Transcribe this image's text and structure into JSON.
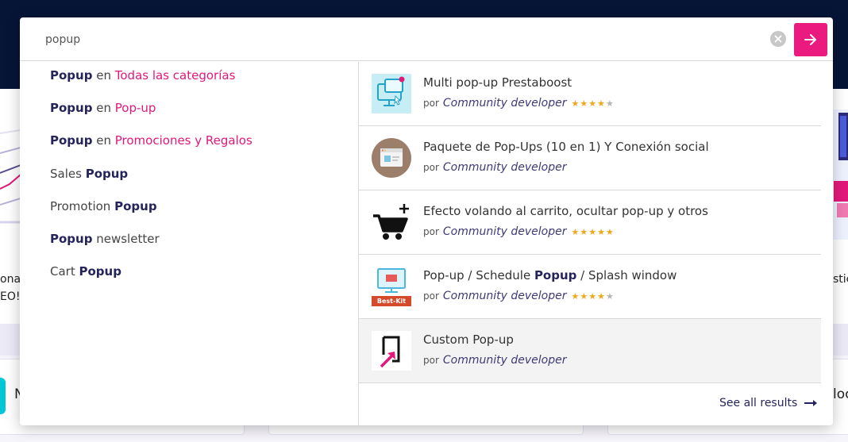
{
  "search": {
    "query": "popup",
    "clear_icon": "clear-icon",
    "submit_icon": "arrow-right-icon",
    "accent_color": "#ea1a7f"
  },
  "background": {
    "left_fragment_1": "onam",
    "left_fragment_2": "EO!",
    "right_fragment_1": "stic",
    "card_left_fragment": "N",
    "card_right_fragment": "loc"
  },
  "suggestions": [
    {
      "keyword": "Popup",
      "connector": "en",
      "category": "Todas las categorías"
    },
    {
      "keyword": "Popup",
      "connector": "en",
      "category": "Pop-up"
    },
    {
      "keyword": "Popup",
      "connector": "en",
      "category": "Promociones y Regalos"
    },
    {
      "prefix": "Sales",
      "keyword": "Popup"
    },
    {
      "prefix": "Promotion",
      "keyword": "Popup"
    },
    {
      "keyword": "Popup",
      "suffix": "newsletter"
    },
    {
      "prefix": "Cart",
      "keyword": "Popup"
    }
  ],
  "results": [
    {
      "title": "Multi pop-up Prestaboost",
      "by": "por",
      "developer": "Community developer",
      "rating": 4,
      "thumb": "monitor-popup-icon"
    },
    {
      "title": "Paquete de Pop-Ups (10 en 1) Y Conexión social",
      "by": "por",
      "developer": "Community developer",
      "rating": 0,
      "thumb": "browser-window-icon"
    },
    {
      "title": "Efecto volando al carrito, ocultar pop-up y otros",
      "by": "por",
      "developer": "Community developer",
      "rating": 5,
      "thumb": "cart-plus-icon"
    },
    {
      "title_pre": "Pop-up / Schedule ",
      "title_bold": "Popup",
      "title_post": " / Splash window",
      "by": "por",
      "developer": "Community developer",
      "rating": 4,
      "thumb": "bestkit-monitor-icon",
      "thumb_text": "Best-Kit"
    },
    {
      "title": "Custom Pop-up",
      "by": "por",
      "developer": "Community developer",
      "rating": 0,
      "thumb": "popup-arrow-icon"
    }
  ],
  "see_all": {
    "label": "See all results",
    "icon": "long-arrow-right-icon"
  }
}
